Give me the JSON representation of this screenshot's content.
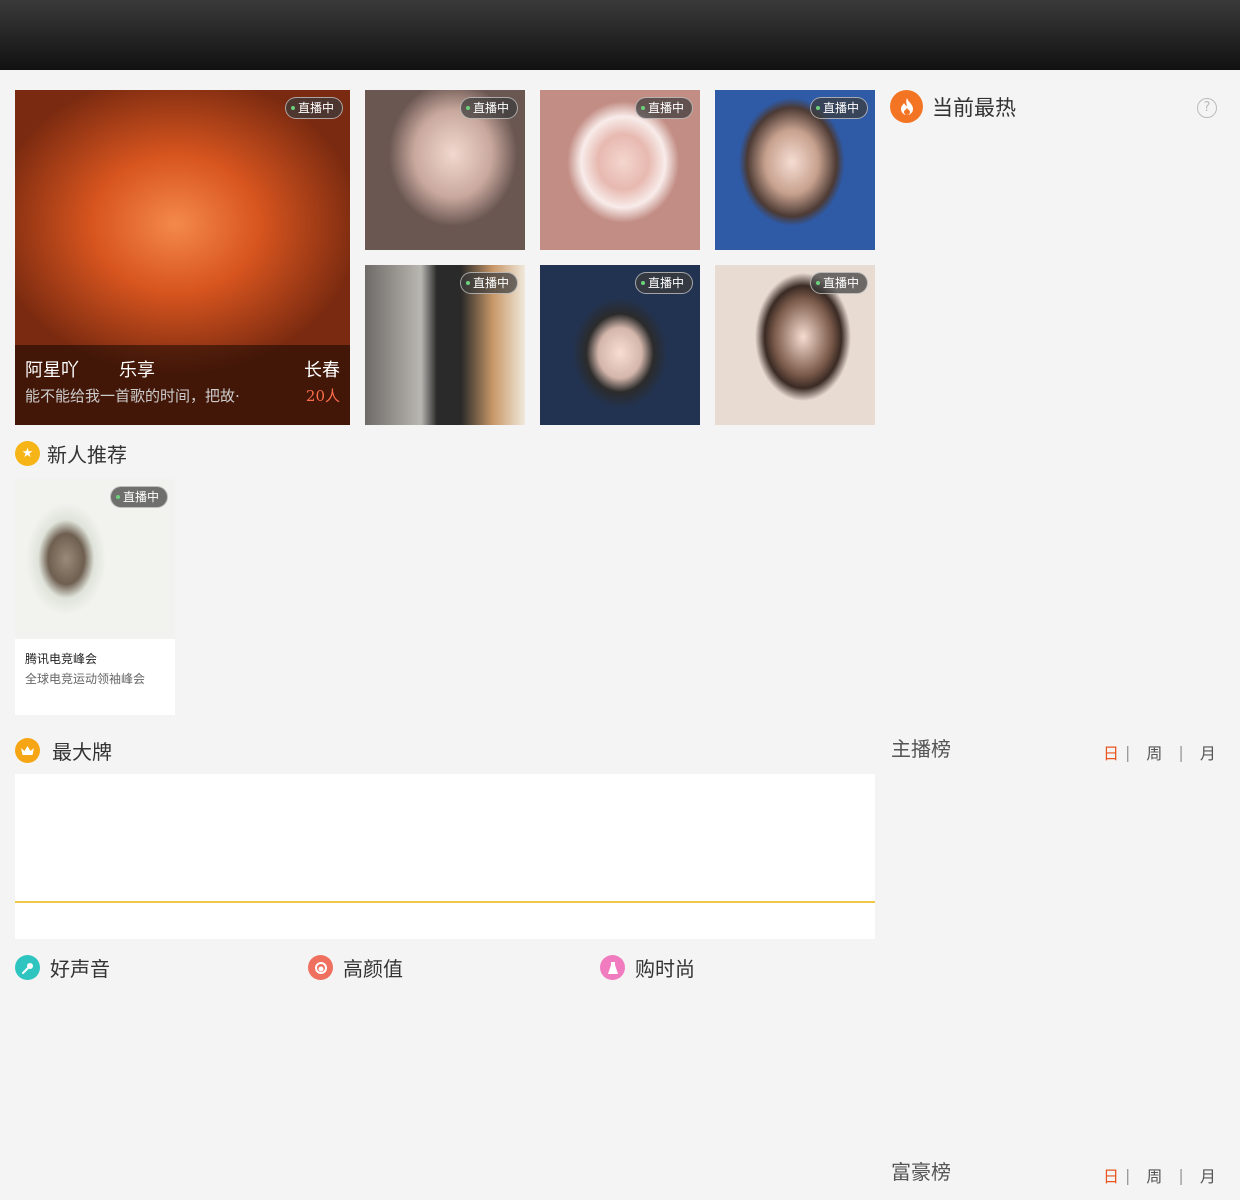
{
  "live_badge_label": "直播中",
  "featured": {
    "name": "阿星吖",
    "category": "乐享",
    "city": "长春",
    "description": "能不能给我一首歌的时间，把故·",
    "viewers": "20人"
  },
  "sections": {
    "hot": "当前最热",
    "newcomer": "新人推荐",
    "top": "最大牌",
    "voice": "好声音",
    "beauty": "高颜值",
    "fashion": "购时尚"
  },
  "newcomer_card": {
    "title": "腾讯电竞峰会",
    "subtitle": "全球电竞运动领袖峰会"
  },
  "anchor_rank": {
    "title": "主播榜",
    "tabs": [
      "日",
      "周",
      "月"
    ],
    "active_tab": "日"
  },
  "rich_rank": {
    "title": "富豪榜",
    "tabs": [
      "日",
      "周",
      "月"
    ],
    "active_tab": "日"
  },
  "colors": {
    "accent": "#e8551f",
    "hot_icon": "#f37423",
    "star_icon": "#f6b417",
    "crown_icon": "#f6a514",
    "voice_icon": "#2ec4c0",
    "beauty_icon": "#f07060",
    "fashion_icon": "#f07cbf",
    "top_line": "#f0c94a"
  }
}
